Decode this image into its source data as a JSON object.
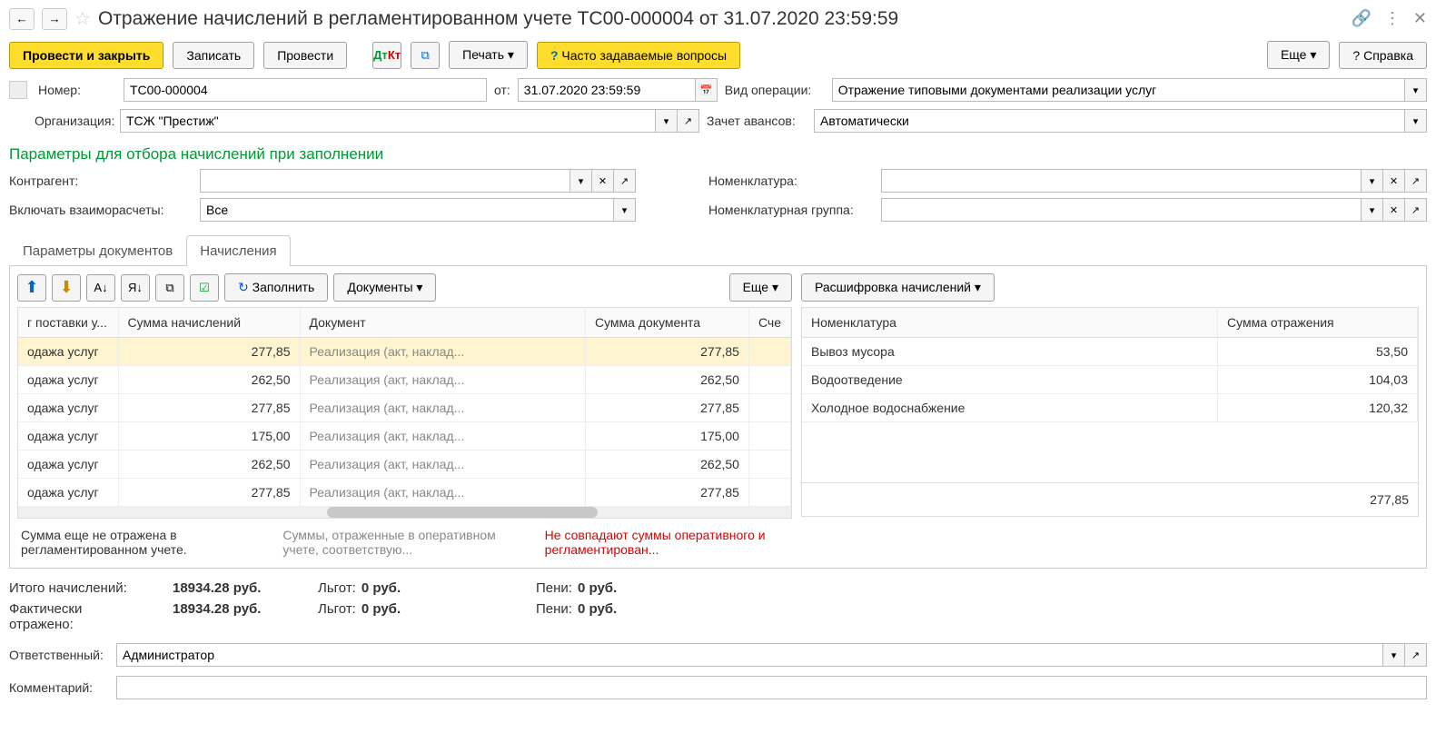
{
  "header": {
    "title": "Отражение начислений в регламентированном учете ТС00-000004 от 31.07.2020 23:59:59"
  },
  "toolbar": {
    "post_close": "Провести и закрыть",
    "save": "Записать",
    "post": "Провести",
    "print": "Печать",
    "faq": "Часто задаваемые вопросы",
    "more": "Еще",
    "help": "Справка"
  },
  "form": {
    "number_label": "Номер:",
    "number": "ТС00-000004",
    "date_label": "от:",
    "date": "31.07.2020 23:59:59",
    "optype_label": "Вид операции:",
    "optype": "Отражение типовыми документами реализации услуг",
    "org_label": "Организация:",
    "org": "ТСЖ \"Престиж\"",
    "advance_label": "Зачет авансов:",
    "advance": "Автоматически"
  },
  "section": {
    "title": "Параметры для отбора начислений при заполнении",
    "contractor_label": "Контрагент:",
    "settlement_label": "Включать взаиморасчеты:",
    "settlement": "Все",
    "nomen_label": "Номенклатура:",
    "nomen_group_label": "Номенклатурная группа:"
  },
  "tabs": {
    "t1": "Параметры документов",
    "t2": "Начисления"
  },
  "leftToolbar": {
    "fill": "Заполнить",
    "docs": "Документы",
    "more": "Еще"
  },
  "rightToolbar": {
    "detail": "Расшифровка начислений"
  },
  "leftTable": {
    "headers": {
      "c1": "г поставки у...",
      "c2": "Сумма начислений",
      "c3": "Документ",
      "c4": "Сумма документа",
      "c5": "Сче"
    },
    "rows": [
      {
        "c1": "одажа услуг",
        "c2": "277,85",
        "c3": "Реализация (акт, наклад...",
        "c4": "277,85"
      },
      {
        "c1": "одажа услуг",
        "c2": "262,50",
        "c3": "Реализация (акт, наклад...",
        "c4": "262,50"
      },
      {
        "c1": "одажа услуг",
        "c2": "277,85",
        "c3": "Реализация (акт, наклад...",
        "c4": "277,85"
      },
      {
        "c1": "одажа услуг",
        "c2": "175,00",
        "c3": "Реализация (акт, наклад...",
        "c4": "175,00"
      },
      {
        "c1": "одажа услуг",
        "c2": "262,50",
        "c3": "Реализация (акт, наклад...",
        "c4": "262,50"
      },
      {
        "c1": "одажа услуг",
        "c2": "277,85",
        "c3": "Реализация (акт, наклад...",
        "c4": "277,85"
      }
    ]
  },
  "rightTable": {
    "headers": {
      "c1": "Номенклатура",
      "c2": "Сумма отражения"
    },
    "rows": [
      {
        "c1": "Вывоз мусора",
        "c2": "53,50"
      },
      {
        "c1": "Водоотведение",
        "c2": "104,03"
      },
      {
        "c1": "Холодное водоснабжение",
        "c2": "120,32"
      }
    ],
    "footer_sum": "277,85"
  },
  "legend": {
    "l1": "Сумма еще не отражена в регламентированном учете.",
    "l2": "Суммы, отраженные в оперативном учете, соответствую...",
    "l3": "Не совпадают суммы оперативного и регламентирован..."
  },
  "totals": {
    "r1_label": "Итого начислений:",
    "r1_v1": "18934.28 руб.",
    "r2_label": "Фактически отражено:",
    "r2_v1": "18934.28 руб.",
    "lgot_label": "Льгот:",
    "lgot_val": "0 руб.",
    "peni_label": "Пени:",
    "peni_val": "0 руб."
  },
  "footer": {
    "resp_label": "Ответственный:",
    "resp": "Администратор",
    "comment_label": "Комментарий:"
  }
}
